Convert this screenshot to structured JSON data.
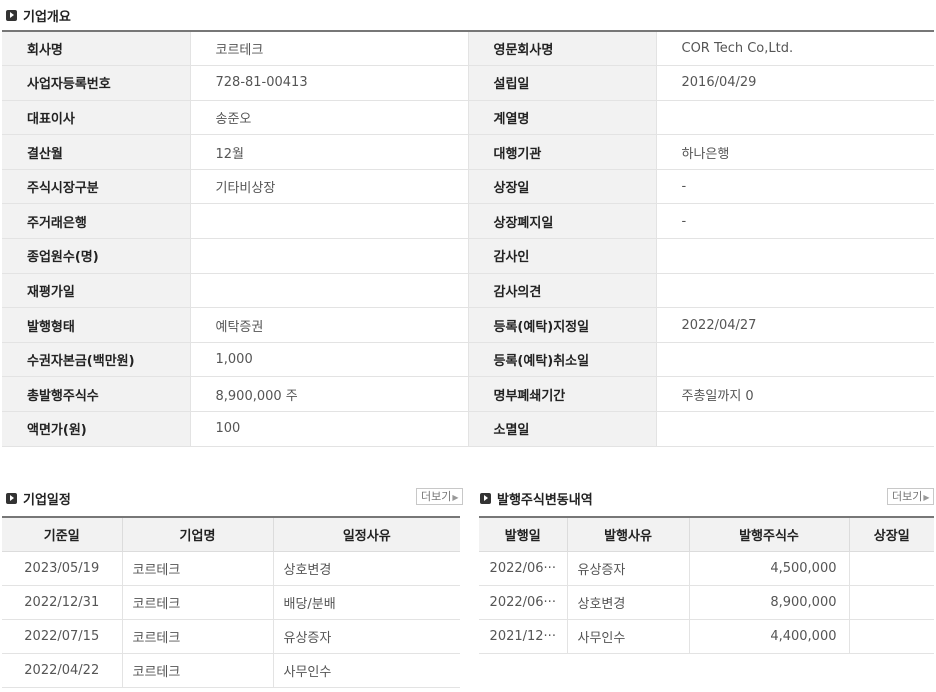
{
  "overview": {
    "title": "기업개요",
    "rows": [
      {
        "l1": "회사명",
        "v1": "코르테크",
        "l2": "영문회사명",
        "v2": "COR Tech Co,Ltd."
      },
      {
        "l1": "사업자등록번호",
        "v1": "728-81-00413",
        "l2": "설립일",
        "v2": "2016/04/29"
      },
      {
        "l1": "대표이사",
        "v1": "송준오",
        "l2": "계열명",
        "v2": ""
      },
      {
        "l1": "결산월",
        "v1": "12월",
        "l2": "대행기관",
        "v2": "하나은행"
      },
      {
        "l1": "주식시장구분",
        "v1": "기타비상장",
        "l2": "상장일",
        "v2": "-"
      },
      {
        "l1": "주거래은행",
        "v1": "",
        "l2": "상장폐지일",
        "v2": "-"
      },
      {
        "l1": "종업원수(명)",
        "v1": "",
        "l2": "감사인",
        "v2": ""
      },
      {
        "l1": "재평가일",
        "v1": "",
        "l2": "감사의견",
        "v2": ""
      },
      {
        "l1": "발행형태",
        "v1": "예탁증권",
        "l2": "등록(예탁)지정일",
        "v2": "2022/04/27"
      },
      {
        "l1": "수권자본금(백만원)",
        "v1": "1,000",
        "l2": "등록(예탁)취소일",
        "v2": ""
      },
      {
        "l1": "총발행주식수",
        "v1": "8,900,000 주",
        "l2": "명부폐쇄기간",
        "v2": "주총일까지 0"
      },
      {
        "l1": "액면가(원)",
        "v1": "100",
        "l2": "소멸일",
        "v2": ""
      }
    ]
  },
  "schedule": {
    "title": "기업일정",
    "more_label": "더보기",
    "headers": [
      "기준일",
      "기업명",
      "일정사유"
    ],
    "rows": [
      [
        "2023/05/19",
        "코르테크",
        "상호변경"
      ],
      [
        "2022/12/31",
        "코르테크",
        "배당/분배"
      ],
      [
        "2022/07/15",
        "코르테크",
        "유상증자"
      ],
      [
        "2022/04/22",
        "코르테크",
        "사무인수"
      ]
    ]
  },
  "shares": {
    "title": "발행주식변동내역",
    "more_label": "더보기",
    "headers": [
      "발행일",
      "발행사유",
      "발행주식수",
      "상장일"
    ],
    "rows": [
      [
        "2022/06···",
        "유상증자",
        "4,500,000",
        ""
      ],
      [
        "2022/06···",
        "상호변경",
        "8,900,000",
        ""
      ],
      [
        "2021/12···",
        "사무인수",
        "4,400,000",
        ""
      ]
    ]
  }
}
